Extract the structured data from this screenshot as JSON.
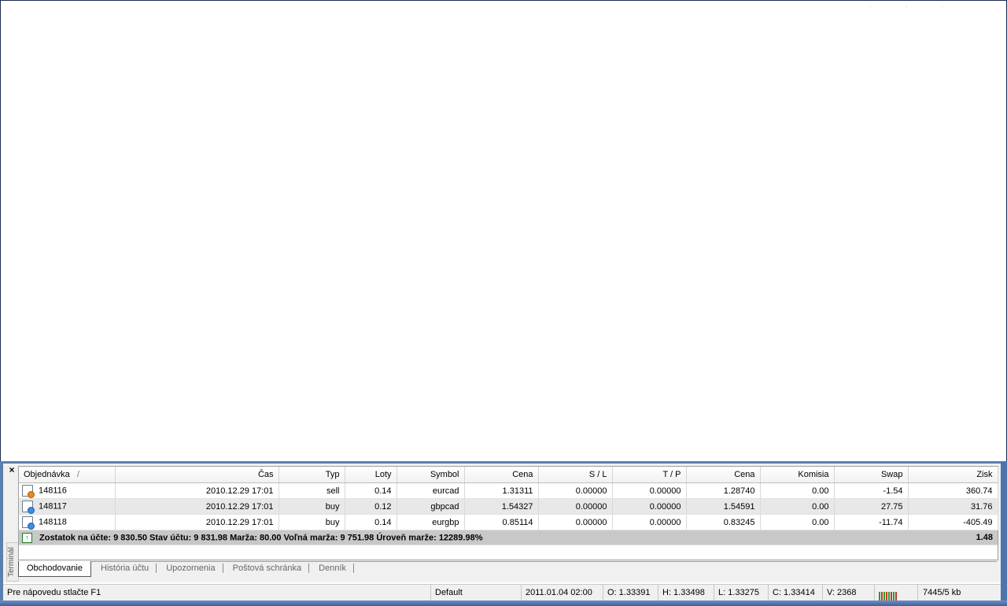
{
  "terminal": {
    "close_label": "×",
    "side_label": "Terminál",
    "columns": [
      "Objednávka",
      "/",
      "Čas",
      "Typ",
      "Loty",
      "Symbol",
      "Cena",
      "S / L",
      "T / P",
      "Cena",
      "Komisia",
      "Swap",
      "Zisk"
    ],
    "rows": [
      {
        "order": "148116",
        "time": "2010.12.29 17:01",
        "type": "sell",
        "lots": "0.14",
        "symbol": "eurcad",
        "open_price": "1.31311",
        "sl": "0.00000",
        "tp": "0.00000",
        "price": "1.28740",
        "commission": "0.00",
        "swap": "-1.54",
        "profit": "360.74"
      },
      {
        "order": "148117",
        "time": "2010.12.29 17:01",
        "type": "buy",
        "lots": "0.12",
        "symbol": "gbpcad",
        "open_price": "1.54327",
        "sl": "0.00000",
        "tp": "0.00000",
        "price": "1.54591",
        "commission": "0.00",
        "swap": "27.75",
        "profit": "31.76"
      },
      {
        "order": "148118",
        "time": "2010.12.29 17:01",
        "type": "buy",
        "lots": "0.14",
        "symbol": "eurgbp",
        "open_price": "0.85114",
        "sl": "0.00000",
        "tp": "0.00000",
        "price": "0.83245",
        "commission": "0.00",
        "swap": "-11.74",
        "profit": "-405.49"
      }
    ],
    "summary": {
      "text": "Zostatok na účte: 9 830.50  Stav účtu: 9 831.98  Marža: 80.00  Voľná marža: 9 751.98  Úroveň marže: 12289.98%",
      "profit": "1.48"
    },
    "tabs": [
      "Obchodovanie",
      "História účtu",
      "Upozornenia",
      "Poštová schránka",
      "Denník"
    ],
    "active_tab": 0
  },
  "status_bar": {
    "help": "Pre nápovedu stlačte F1",
    "profile": "Default",
    "datetime": "2011.01.04 02:00",
    "open": "O: 1.33391",
    "high": "H: 1.33498",
    "low": "L: 1.33275",
    "close": "C: 1.33414",
    "volume": "V: 2368",
    "traffic": "7445/5 kb"
  },
  "colors": {
    "frame": "#5d7fb0",
    "sell_icon": "#e58b1d",
    "buy_icon": "#3a8ee6",
    "summary_bg": "#c8c8c8",
    "signal_green": "#2e9b2e",
    "signal_red": "#c0392b"
  }
}
